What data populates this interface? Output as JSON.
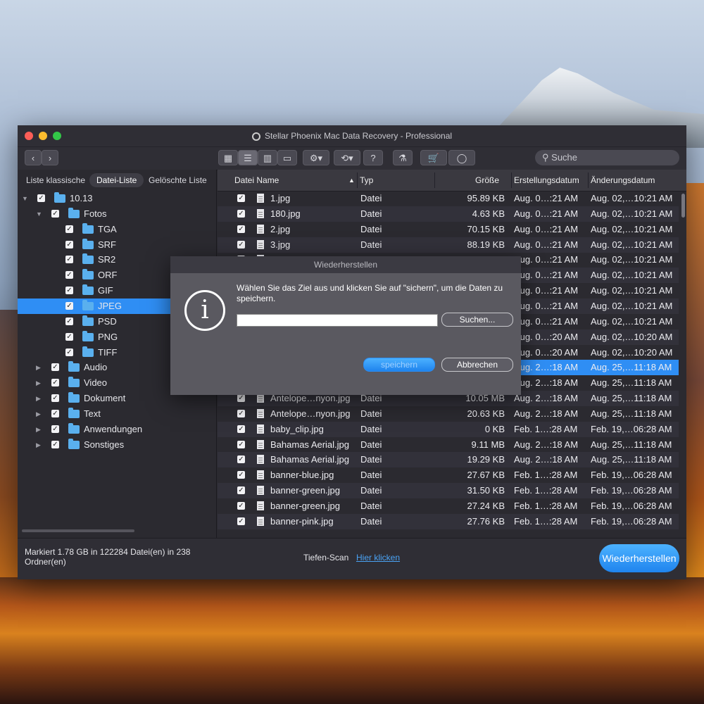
{
  "window": {
    "title": "Stellar Phoenix Mac Data Recovery - Professional"
  },
  "toolbar": {
    "search_placeholder": "Suche",
    "help_label": "?"
  },
  "sidebar": {
    "tabs": [
      "Liste klassische",
      "Datei-Liste",
      "Gelöschte Liste"
    ],
    "selected_tab": "Datei-Liste",
    "tree": [
      {
        "label": "10.13",
        "level": 0,
        "expanded": true,
        "checked": true
      },
      {
        "label": "Fotos",
        "level": 1,
        "expanded": true,
        "checked": true
      },
      {
        "label": "TGA",
        "level": 2,
        "checked": true
      },
      {
        "label": "SRF",
        "level": 2,
        "checked": true
      },
      {
        "label": "SR2",
        "level": 2,
        "checked": true
      },
      {
        "label": "ORF",
        "level": 2,
        "checked": true
      },
      {
        "label": "GIF",
        "level": 2,
        "checked": true
      },
      {
        "label": "JPEG",
        "level": 2,
        "checked": true,
        "selected": true
      },
      {
        "label": "PSD",
        "level": 2,
        "checked": true
      },
      {
        "label": "PNG",
        "level": 2,
        "checked": true
      },
      {
        "label": "TIFF",
        "level": 2,
        "checked": true
      },
      {
        "label": "Audio",
        "level": 1,
        "expanded": false,
        "checked": true
      },
      {
        "label": "Video",
        "level": 1,
        "expanded": false,
        "checked": true
      },
      {
        "label": "Dokument",
        "level": 1,
        "expanded": false,
        "checked": true
      },
      {
        "label": "Text",
        "level": 1,
        "expanded": false,
        "checked": true
      },
      {
        "label": "Anwendungen",
        "level": 1,
        "expanded": false,
        "checked": true
      },
      {
        "label": "Sonstiges",
        "level": 1,
        "expanded": false,
        "checked": true
      }
    ]
  },
  "table": {
    "columns": [
      "Datei Name",
      "Typ",
      "Größe",
      "Erstellungsdatum",
      "Änderungsdatum"
    ],
    "rows": [
      {
        "name": "1.jpg",
        "type": "Datei",
        "size": "95.89 KB",
        "created": "Aug. 0…:21 AM",
        "modified": "Aug. 02,…10:21 AM"
      },
      {
        "name": "180.jpg",
        "type": "Datei",
        "size": "4.63 KB",
        "created": "Aug. 0…:21 AM",
        "modified": "Aug. 02,…10:21 AM"
      },
      {
        "name": "2.jpg",
        "type": "Datei",
        "size": "70.15 KB",
        "created": "Aug. 0…:21 AM",
        "modified": "Aug. 02,…10:21 AM"
      },
      {
        "name": "3.jpg",
        "type": "Datei",
        "size": "88.19 KB",
        "created": "Aug. 0…:21 AM",
        "modified": "Aug. 02,…10:21 AM"
      },
      {
        "name": "",
        "type": "",
        "size": "",
        "created": "Aug. 0…:21 AM",
        "modified": "Aug. 02,…10:21 AM"
      },
      {
        "name": "",
        "type": "",
        "size": "",
        "created": "Aug. 0…:21 AM",
        "modified": "Aug. 02,…10:21 AM"
      },
      {
        "name": "",
        "type": "",
        "size": "",
        "created": "Aug. 0…:21 AM",
        "modified": "Aug. 02,…10:21 AM"
      },
      {
        "name": "",
        "type": "",
        "size": "",
        "created": "Aug. 0…:21 AM",
        "modified": "Aug. 02,…10:21 AM"
      },
      {
        "name": "",
        "type": "",
        "size": "",
        "created": "Aug. 0…:21 AM",
        "modified": "Aug. 02,…10:21 AM"
      },
      {
        "name": "",
        "type": "",
        "size": "",
        "created": "Aug. 0…:20 AM",
        "modified": "Aug. 02,…10:20 AM"
      },
      {
        "name": "",
        "type": "",
        "size": "",
        "created": "Aug. 0…:20 AM",
        "modified": "Aug. 02,…10:20 AM"
      },
      {
        "name": "",
        "type": "",
        "size": "",
        "created": "Aug. 2…:18 AM",
        "modified": "Aug. 25,…11:18 AM",
        "selected": true
      },
      {
        "name": "",
        "type": "",
        "size": "",
        "created": "Aug. 2…:18 AM",
        "modified": "Aug. 25,…11:18 AM"
      },
      {
        "name": "Antelope…nyon.jpg",
        "type": "Datei",
        "size": "10.05 MB",
        "created": "Aug. 2…:18 AM",
        "modified": "Aug. 25,…11:18 AM"
      },
      {
        "name": "Antelope…nyon.jpg",
        "type": "Datei",
        "size": "20.63 KB",
        "created": "Aug. 2…:18 AM",
        "modified": "Aug. 25,…11:18 AM"
      },
      {
        "name": "baby_clip.jpg",
        "type": "Datei",
        "size": "0 KB",
        "created": "Feb. 1…:28 AM",
        "modified": "Feb. 19,…06:28 AM"
      },
      {
        "name": "Bahamas Aerial.jpg",
        "type": "Datei",
        "size": "9.11 MB",
        "created": "Aug. 2…:18 AM",
        "modified": "Aug. 25,…11:18 AM"
      },
      {
        "name": "Bahamas Aerial.jpg",
        "type": "Datei",
        "size": "19.29 KB",
        "created": "Aug. 2…:18 AM",
        "modified": "Aug. 25,…11:18 AM"
      },
      {
        "name": "banner-blue.jpg",
        "type": "Datei",
        "size": "27.67 KB",
        "created": "Feb. 1…:28 AM",
        "modified": "Feb. 19,…06:28 AM"
      },
      {
        "name": "banner-green.jpg",
        "type": "Datei",
        "size": "31.50 KB",
        "created": "Feb. 1…:28 AM",
        "modified": "Feb. 19,…06:28 AM"
      },
      {
        "name": "banner-green.jpg",
        "type": "Datei",
        "size": "27.24 KB",
        "created": "Feb. 1…:28 AM",
        "modified": "Feb. 19,…06:28 AM"
      },
      {
        "name": "banner-pink.jpg",
        "type": "Datei",
        "size": "27.76 KB",
        "created": "Feb. 1…:28 AM",
        "modified": "Feb. 19,…06:28 AM"
      }
    ]
  },
  "status": {
    "summary": "Markiert 1.78 GB in 122284 Datei(en) in 238 Ordner(en)",
    "deep_scan_label": "Tiefen-Scan",
    "deep_scan_link": "Hier klicken",
    "recover_button": "Wiederherstellen"
  },
  "dialog": {
    "title": "Wiederherstellen",
    "message": "Wählen Sie das Ziel aus und klicken Sie auf \"sichern\", um die Daten zu speichern.",
    "path_value": "",
    "browse_button": "Suchen...",
    "save_button": "speichern",
    "cancel_button": "Abbrechen"
  },
  "colors": {
    "accent": "#2f8ef4",
    "folder": "#5ab0ee",
    "link": "#4aa3f5"
  }
}
